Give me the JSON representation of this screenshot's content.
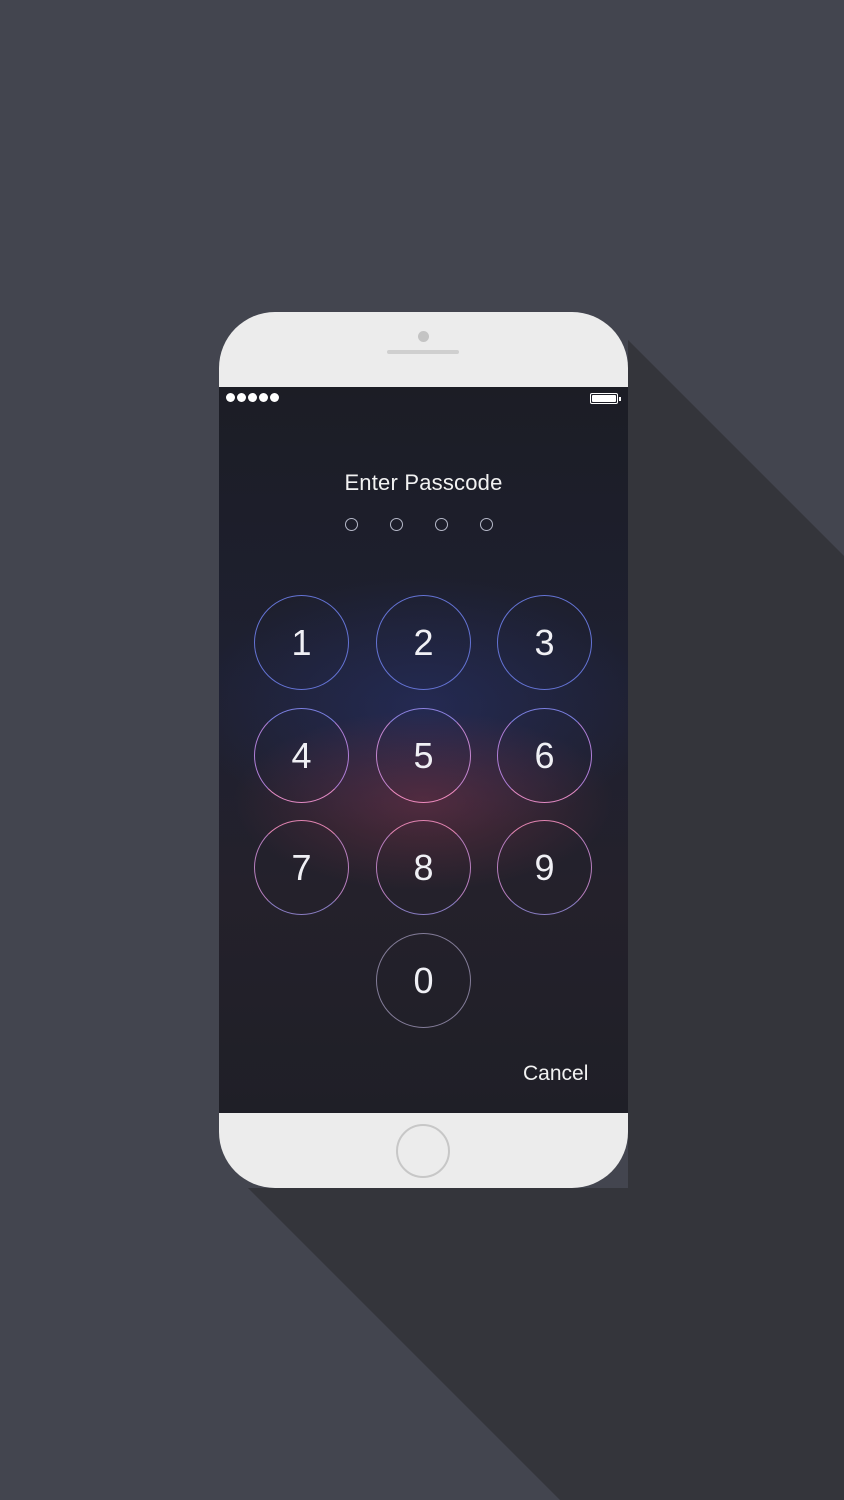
{
  "status_bar": {
    "signal_dots": 5,
    "battery_level": 1.0
  },
  "lock_screen": {
    "title": "Enter Passcode",
    "passcode_length": 4,
    "keys": [
      "1",
      "2",
      "3",
      "4",
      "5",
      "6",
      "7",
      "8",
      "9",
      "0"
    ],
    "cancel_label": "Cancel"
  },
  "colors": {
    "background": "#43454f",
    "shadow": "#33343a",
    "phone_body": "#ececec",
    "key_ring_top": "#6e7fd8",
    "key_ring_middle": "#d985c0",
    "key_ring_bottom": "#8d7fb0",
    "key_zero_ring": "#8a839c"
  }
}
